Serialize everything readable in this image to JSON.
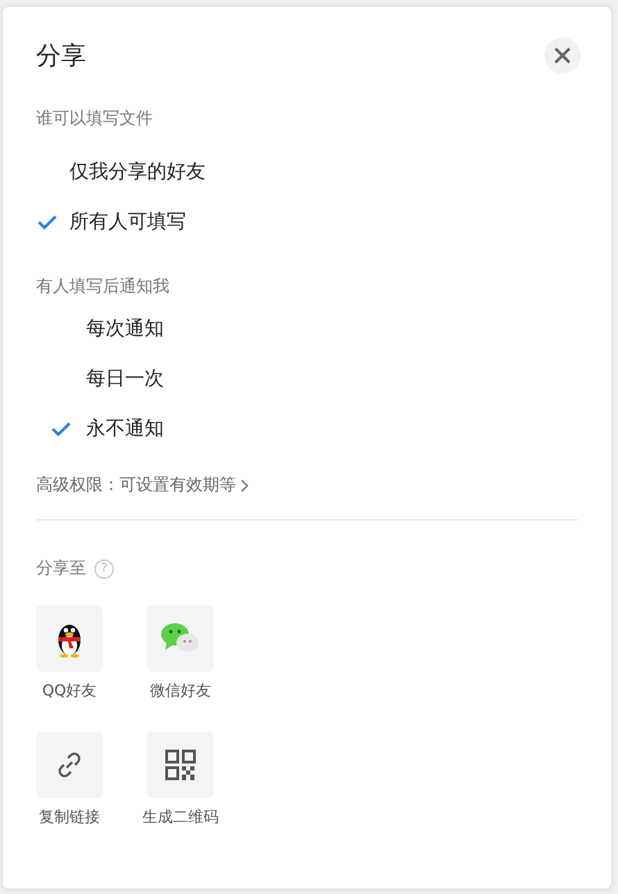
{
  "dialog": {
    "title": "分享"
  },
  "fill_permission": {
    "label": "谁可以填写文件",
    "options": [
      {
        "label": "仅我分享的好友",
        "selected": false
      },
      {
        "label": "所有人可填写",
        "selected": true
      }
    ]
  },
  "notify": {
    "label": "有人填写后通知我",
    "options": [
      {
        "label": "每次通知",
        "selected": false
      },
      {
        "label": "每日一次",
        "selected": false
      },
      {
        "label": "永不通知",
        "selected": true
      }
    ]
  },
  "advanced_link": "高级权限：可设置有效期等",
  "share_to": {
    "label": "分享至",
    "help": "?",
    "targets": [
      {
        "kind": "qq",
        "label": "QQ好友"
      },
      {
        "kind": "wechat",
        "label": "微信好友"
      },
      {
        "kind": "link",
        "label": "复制链接"
      },
      {
        "kind": "qrcode",
        "label": "生成二维码"
      }
    ]
  }
}
